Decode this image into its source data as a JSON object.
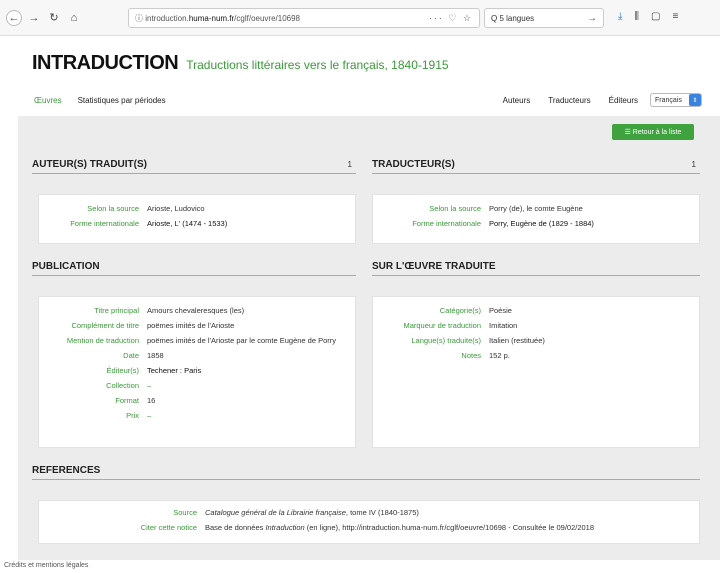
{
  "browser": {
    "url_prefix": "ⓘ introduction.",
    "url_domain": "huma-num.fr",
    "url_path": "/cglf/oeuvre/10698",
    "url_actions": "··· ♡ ☆",
    "search": "Q 5 langues"
  },
  "site": {
    "brand": "INTRADUCTION",
    "subtitle": "Traductions littéraires vers le français, 1840-1915"
  },
  "nav": {
    "oeuvres": "Œuvres",
    "stats": "Statistiques par périodes",
    "auteurs": "Auteurs",
    "traducteurs": "Traducteurs",
    "editeurs": "Éditeurs",
    "lang": "Français"
  },
  "back_button": "☰ Retour à la liste",
  "auteurs": {
    "heading": "AUTEUR(S) TRADUIT(S)",
    "count": "1",
    "rows": [
      {
        "label": "Selon la source",
        "value": "Arioste, Ludovico"
      },
      {
        "label": "Forme internationale",
        "value": "Arioste, L' (1474 - 1533)"
      }
    ]
  },
  "traducteurs": {
    "heading": "TRADUCTEUR(S)",
    "count": "1",
    "rows": [
      {
        "label": "Selon la source",
        "value": "Porry (de), le comte Eugène"
      },
      {
        "label": "Forme internationale",
        "value": "Porry, Eugène de (1829 - 1884)"
      }
    ]
  },
  "publication": {
    "heading": "PUBLICATION",
    "rows": [
      {
        "label": "Titre principal",
        "value": "Amours chevaleresques (les)"
      },
      {
        "label": "Complément de titre",
        "value": "poëmes imités de l'Arioste"
      },
      {
        "label": "Mention de traduction",
        "value": "poëmes imités de l'Arioste par le comte Eugène de Porry"
      },
      {
        "label": "Date",
        "value": "1858"
      },
      {
        "label": "Éditeur(s)",
        "value": "Techener : Paris"
      },
      {
        "label": "Collection",
        "value": "–"
      },
      {
        "label": "Format",
        "value": "16"
      },
      {
        "label": "Prix",
        "value": "–"
      }
    ]
  },
  "oeuvre": {
    "heading": "SUR L'ŒUVRE TRADUITE",
    "rows": [
      {
        "label": "Catégorie(s)",
        "value": "Poésie"
      },
      {
        "label": "Marqueur de traduction",
        "value": "Imitation"
      },
      {
        "label": "Langue(s) traduite(s)",
        "value": "Italien (restituée)"
      },
      {
        "label": "Notes",
        "value": "152 p."
      }
    ]
  },
  "references": {
    "heading": "REFERENCES",
    "source_label": "Source",
    "source_title": "Catalogue général de la Librairie française",
    "source_rest": ", tome IV (1840-1875)",
    "cite_label": "Citer cette notice",
    "cite_pre": "Base de données ",
    "cite_italic": "Intraduction",
    "cite_post": " (en ligne), http://intraduction.huma-num.fr/cglf/oeuvre/10698 - Consultée le 09/02/2018"
  },
  "footer": "Crédits et mentions légales"
}
